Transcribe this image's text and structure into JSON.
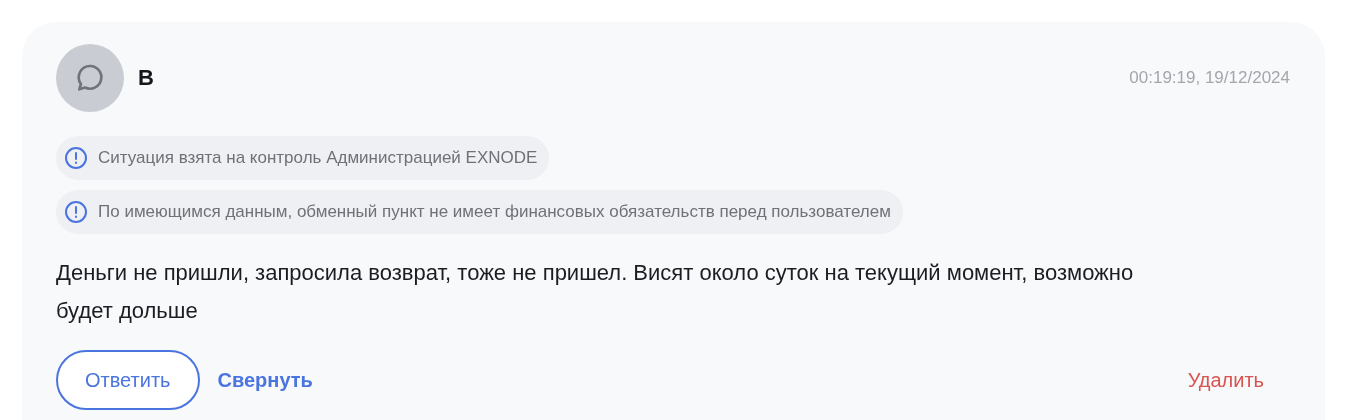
{
  "review": {
    "author": "В",
    "timestamp": "00:19:19, 19/12/2024",
    "notices": [
      {
        "text": "Ситуация взята на контроль Администрацией EXNODE"
      },
      {
        "text": "По имеющимся данным, обменный пункт не имеет финансовых обязательств перед пользователем"
      }
    ],
    "message": "Деньги не пришли, запросила возврат, тоже не пришел. Висят около суток на текущий момент, возможно будет дольше",
    "actions": {
      "reply": "Ответить",
      "collapse": "Свернуть",
      "delete": "Удалить"
    }
  }
}
